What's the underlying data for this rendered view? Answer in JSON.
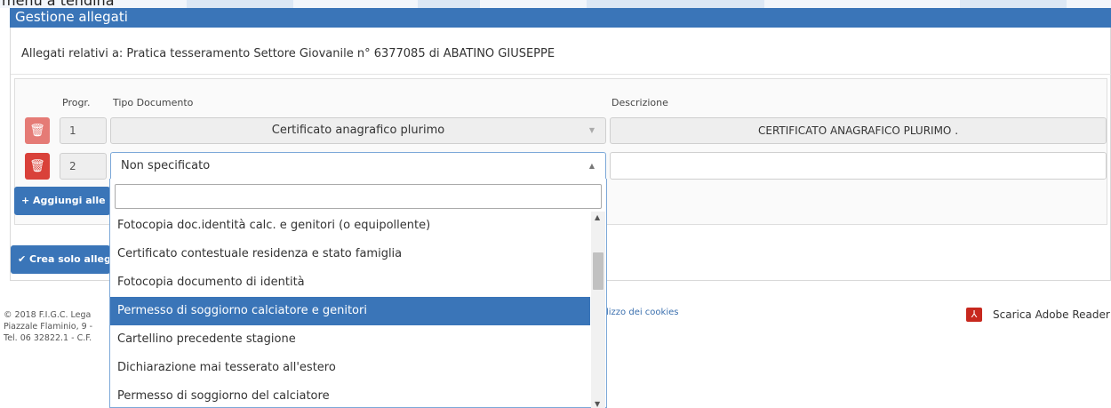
{
  "topstrip": {
    "cut_text": "menù a tendina"
  },
  "header": {
    "title": "Gestione allegati"
  },
  "subtitle": "Allegati relativi a: Pratica tesseramento Settore Giovanile n° 6377085 di ABATINO GIUSEPPE",
  "columns": {
    "progr": "Progr.",
    "tipo": "Tipo Documento",
    "descrizione": "Descrizione"
  },
  "rows": [
    {
      "progr": "1",
      "tipo": "Certificato anagrafico plurimo",
      "descrizione": "CERTIFICATO ANAGRAFICO PLURIMO ."
    },
    {
      "progr": "2",
      "tipo": "Non specificato",
      "descrizione": ""
    }
  ],
  "buttons": {
    "add": "+ Aggiungi alle",
    "create": "✔ Crea solo alleg"
  },
  "dropdown": {
    "search_value": "",
    "options": [
      "Fotocopia doc.identità calc. e genitori (o equipollente)",
      "Certificato contestuale residenza e stato famiglia",
      "Fotocopia documento di identità",
      "Permesso di soggiorno calciatore e genitori",
      "Cartellino precedente stagione",
      "Dichiarazione mai tesserato all'estero",
      "Permesso di soggiorno del calciatore"
    ],
    "highlighted_index": 3
  },
  "footer": {
    "line1": "© 2018 F.I.G.C. Lega",
    "line2": "Piazzale Flaminio, 9 -",
    "line3": "Tel. 06 32822.1 - C.F.",
    "cookies_link": "lizzo dei cookies",
    "adobe": "Scarica Adobe Reader"
  },
  "colors": {
    "primary": "#3a75b8",
    "danger": "#d9413a",
    "pdf": "#c7281e"
  },
  "icons": {
    "trash": "trash-icon",
    "pdf": "pdf-icon",
    "chevron": "chevron-icon"
  }
}
